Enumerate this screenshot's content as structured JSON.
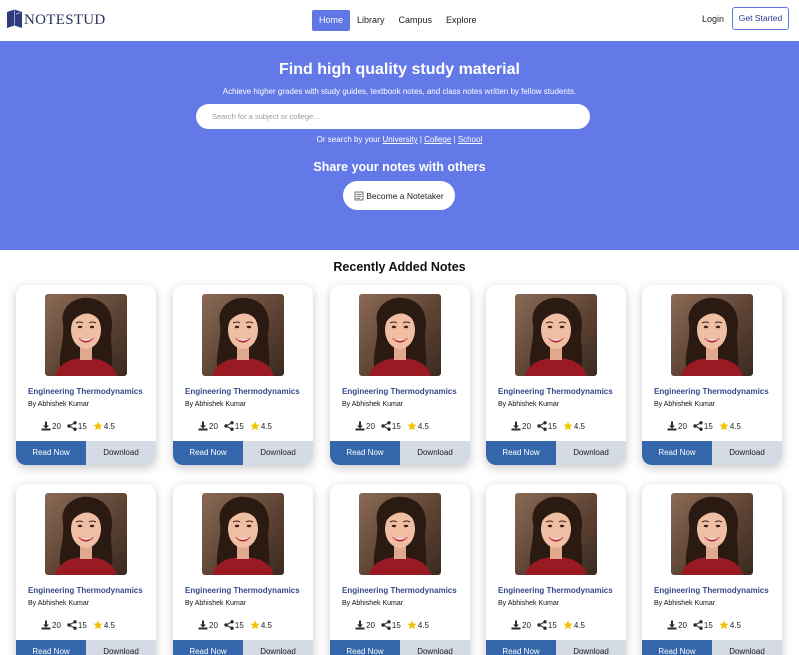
{
  "brand": {
    "name": "NOTESTUD"
  },
  "nav": {
    "links": [
      "Home",
      "Library",
      "Campus",
      "Explore"
    ],
    "login": "Login",
    "get_started": "Get Started"
  },
  "hero": {
    "title": "Find high quality study material",
    "subtitle": "Achieve higher grades with study guides, textbook notes, and class notes written by fellow students.",
    "search_placeholder": "Search for a subject or college...",
    "or_search_prefix": "Or search by your",
    "links": [
      "University",
      "College",
      "School"
    ],
    "separator": "|",
    "share_title": "Share your notes with others",
    "become_button": "Become a Notetaker"
  },
  "recent": {
    "title": "Recently Added Notes",
    "cards": [
      {
        "title": "Engineering Thermodynamics",
        "author": "By Abhishek Kumar",
        "downloads": "20",
        "shares": "15",
        "rating": "4.5",
        "read_label": "Read Now",
        "download_label": "Download"
      },
      {
        "title": "Engineering Thermodynamics",
        "author": "By Abhishek Kumar",
        "downloads": "20",
        "shares": "15",
        "rating": "4.5",
        "read_label": "Read Now",
        "download_label": "Download"
      },
      {
        "title": "Engineering Thermodynamics",
        "author": "By Abhishek Kumar",
        "downloads": "20",
        "shares": "15",
        "rating": "4.5",
        "read_label": "Read Now",
        "download_label": "Download"
      },
      {
        "title": "Engineering Thermodynamics",
        "author": "By Abhishek Kumar",
        "downloads": "20",
        "shares": "15",
        "rating": "4.5",
        "read_label": "Read Now",
        "download_label": "Download"
      },
      {
        "title": "Engineering Thermodynamics",
        "author": "By Abhishek Kumar",
        "downloads": "20",
        "shares": "15",
        "rating": "4.5",
        "read_label": "Read Now",
        "download_label": "Download"
      },
      {
        "title": "Engineering Thermodynamics",
        "author": "By Abhishek Kumar",
        "downloads": "20",
        "shares": "15",
        "rating": "4.5",
        "read_label": "Read Now",
        "download_label": "Download"
      },
      {
        "title": "Engineering Thermodynamics",
        "author": "By Abhishek Kumar",
        "downloads": "20",
        "shares": "15",
        "rating": "4.5",
        "read_label": "Read Now",
        "download_label": "Download"
      },
      {
        "title": "Engineering Thermodynamics",
        "author": "By Abhishek Kumar",
        "downloads": "20",
        "shares": "15",
        "rating": "4.5",
        "read_label": "Read Now",
        "download_label": "Download"
      },
      {
        "title": "Engineering Thermodynamics",
        "author": "By Abhishek Kumar",
        "downloads": "20",
        "shares": "15",
        "rating": "4.5",
        "read_label": "Read Now",
        "download_label": "Download"
      },
      {
        "title": "Engineering Thermodynamics",
        "author": "By Abhishek Kumar",
        "downloads": "20",
        "shares": "15",
        "rating": "4.5",
        "read_label": "Read Now",
        "download_label": "Download"
      }
    ]
  },
  "colors": {
    "accent": "#6279e7",
    "read_button": "#3366aa",
    "download_button": "#d4dbe4",
    "card_title": "#35498a",
    "star": "#f2c200"
  },
  "icons": {
    "brand": "book-logo-icon",
    "downloads": "download-icon",
    "shares": "share-icon",
    "rating": "star-icon",
    "become": "notebook-icon"
  }
}
